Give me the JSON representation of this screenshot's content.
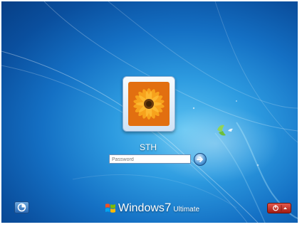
{
  "login": {
    "username": "STH",
    "password_placeholder": "Password"
  },
  "branding": {
    "windows_word": "Windows",
    "version_number": "7",
    "edition": "Ultimate"
  },
  "icons": {
    "submit": "arrow-right-icon",
    "ease_of_access": "ease-of-access-icon",
    "power": "power-icon",
    "options": "triangle-up-icon",
    "logo": "windows-flag-icon"
  },
  "colors": {
    "background": "#1a78c9",
    "power_button": "#c0302a",
    "text": "#ffffff"
  }
}
